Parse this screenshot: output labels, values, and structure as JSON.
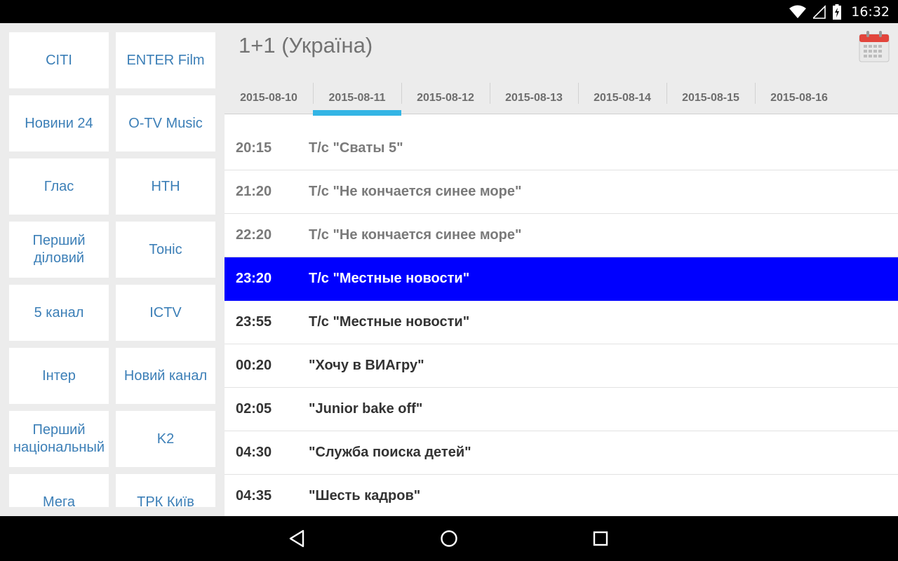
{
  "status_bar": {
    "time": "16:32",
    "icons": [
      "wifi-icon",
      "signal-icon",
      "battery-charging-icon"
    ]
  },
  "channels": [
    "CITI",
    "ENTER Film",
    "Новини 24",
    "O-TV Music",
    "Глас",
    "НТН",
    "Перший діловий",
    "Тоніс",
    "5 канал",
    "ICTV",
    "Інтер",
    "Новий канал",
    "Перший національный",
    "K2",
    "Мега",
    "ТРК Київ"
  ],
  "header": {
    "channel_title": "1+1 (Україна)",
    "calendar_icon": "calendar-icon"
  },
  "tabs": [
    {
      "label": "2015-08-10",
      "active": false
    },
    {
      "label": "2015-08-11",
      "active": true
    },
    {
      "label": "2015-08-12",
      "active": false
    },
    {
      "label": "2015-08-13",
      "active": false
    },
    {
      "label": "2015-08-14",
      "active": false
    },
    {
      "label": "2015-08-15",
      "active": false
    },
    {
      "label": "2015-08-16",
      "active": false
    }
  ],
  "schedule": [
    {
      "time": "20:15",
      "title": "Т/с \"Сваты 5\"",
      "state": "past"
    },
    {
      "time": "21:20",
      "title": "Т/с \"Не кончается синее море\"",
      "state": "past"
    },
    {
      "time": "22:20",
      "title": "Т/с \"Не кончается синее море\"",
      "state": "past"
    },
    {
      "time": "23:20",
      "title": "Т/с \"Местные новости\"",
      "state": "current"
    },
    {
      "time": "23:55",
      "title": "Т/с \"Местные новости\"",
      "state": "upcoming"
    },
    {
      "time": "00:20",
      "title": "\"Хочу в ВИАгру\"",
      "state": "upcoming"
    },
    {
      "time": "02:05",
      "title": "\"Junior bake off\"",
      "state": "upcoming"
    },
    {
      "time": "04:30",
      "title": "\"Служба поиска детей\"",
      "state": "upcoming"
    },
    {
      "time": "04:35",
      "title": "\"Шесть кадров\"",
      "state": "upcoming"
    }
  ],
  "colors": {
    "accent": "#33b5e5",
    "current_row": "#0000ff",
    "channel_text": "#3c7fb7"
  },
  "nav_bar": [
    "back-icon",
    "home-icon",
    "recents-icon"
  ]
}
